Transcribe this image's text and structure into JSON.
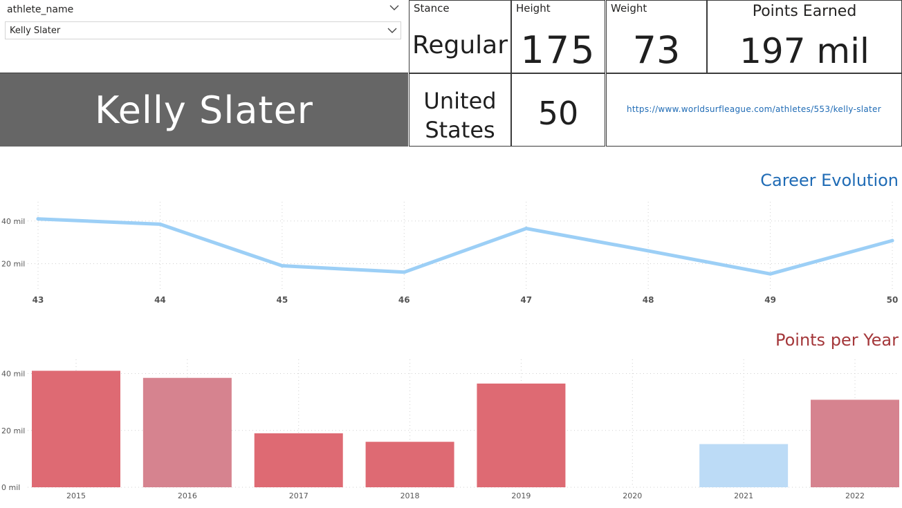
{
  "slicer": {
    "title": "athlete_name",
    "selected": "Kelly Slater"
  },
  "athlete": {
    "name": "Kelly Slater",
    "stance_label": "Stance",
    "stance": "Regular",
    "height_label": "Height",
    "height": "175",
    "weight_label": "Weight",
    "weight": "73",
    "points_label": "Points Earned",
    "points": "197 mil",
    "country_line1": "United",
    "country_line2": "States",
    "age": "50",
    "url": "https://www.worldsurfleague.com/athletes/553/kelly-slater"
  },
  "colors": {
    "line": "#9ccff6",
    "bar_red": "#de6a73",
    "bar_pink": "#d6838f",
    "bar_blue": "#bcdbf6",
    "career_title": "#1f6bb5",
    "points_title": "#a4373a"
  },
  "chart_data": [
    {
      "type": "line",
      "title": "Career Evolution",
      "x": [
        "43",
        "44",
        "45",
        "46",
        "47",
        "48",
        "49",
        "50"
      ],
      "series": [
        {
          "values": [
            41,
            38.5,
            19,
            16,
            36.5,
            26,
            15.2,
            30.8
          ]
        }
      ],
      "yticks": [
        "20 mil",
        "40 mil"
      ],
      "ytick_values": [
        20,
        40
      ],
      "ylim": [
        7.5,
        49
      ],
      "grid": true
    },
    {
      "type": "bar",
      "title": "Points per Year",
      "categories": [
        "2015",
        "2016",
        "2017",
        "2018",
        "2019",
        "2020",
        "2021",
        "2022"
      ],
      "values": [
        41,
        38.5,
        19,
        16,
        36.5,
        0,
        15.2,
        30.8
      ],
      "bar_colors": [
        "bar_red",
        "bar_pink",
        "bar_red",
        "bar_red",
        "bar_red",
        "bar_red",
        "bar_blue",
        "bar_pink"
      ],
      "yticks": [
        "0 mil",
        "20 mil",
        "40 mil"
      ],
      "ytick_values": [
        0,
        20,
        40
      ],
      "ylim": [
        0,
        45
      ],
      "grid": true
    }
  ]
}
